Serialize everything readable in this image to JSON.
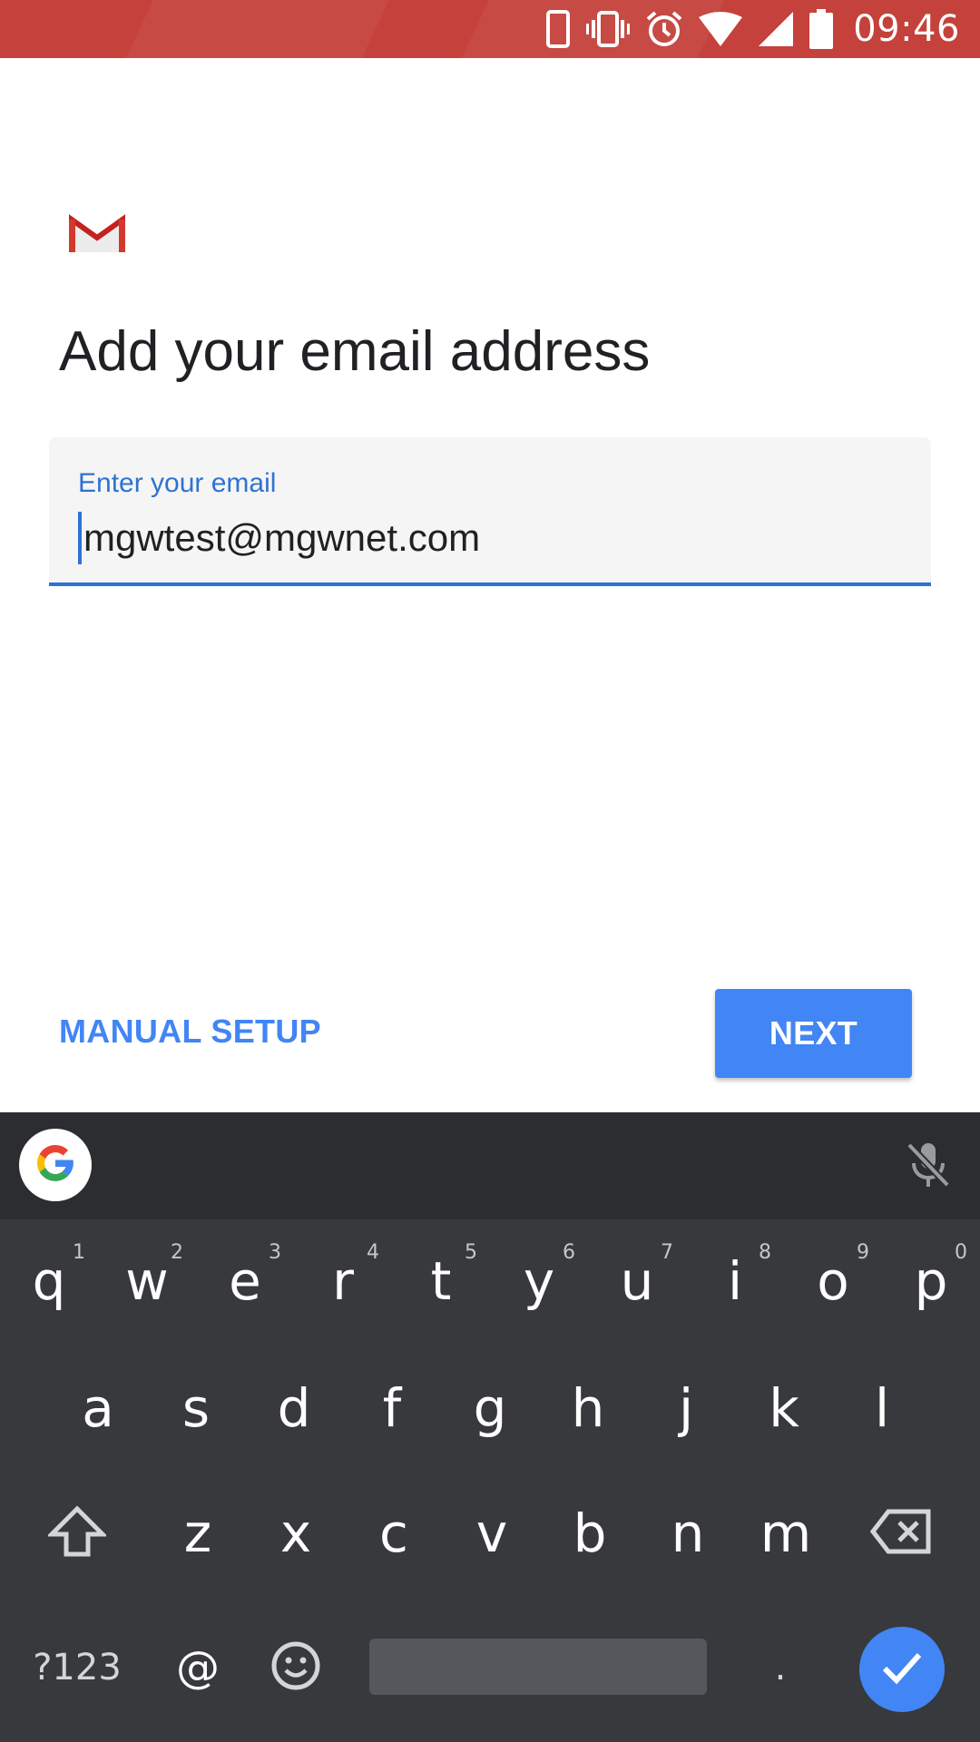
{
  "status_bar": {
    "time": "09:46",
    "icons": [
      "phone-icon",
      "vibrate-icon",
      "alarm-icon",
      "wifi-icon",
      "signal-icon",
      "battery-icon"
    ],
    "background": "#c5413b"
  },
  "logo": {
    "icon": "gmail-logo-icon"
  },
  "title": "Add your email address",
  "email_field": {
    "label": "Enter your email",
    "value": "mgwtest@mgwnet.com"
  },
  "actions": {
    "manual_setup": "MANUAL SETUP",
    "next": "NEXT"
  },
  "keyboard": {
    "row1": [
      {
        "char": "q",
        "hint": "1"
      },
      {
        "char": "w",
        "hint": "2"
      },
      {
        "char": "e",
        "hint": "3"
      },
      {
        "char": "r",
        "hint": "4"
      },
      {
        "char": "t",
        "hint": "5"
      },
      {
        "char": "y",
        "hint": "6"
      },
      {
        "char": "u",
        "hint": "7"
      },
      {
        "char": "i",
        "hint": "8"
      },
      {
        "char": "o",
        "hint": "9"
      },
      {
        "char": "p",
        "hint": "0"
      }
    ],
    "row2": [
      "a",
      "s",
      "d",
      "f",
      "g",
      "h",
      "j",
      "k",
      "l"
    ],
    "row3": [
      "z",
      "x",
      "c",
      "v",
      "b",
      "n",
      "m"
    ],
    "row4": {
      "symbols": "?123",
      "at": "@",
      "period": "."
    }
  },
  "colors": {
    "accent": "#4285f4",
    "field_underline": "#2e72d2",
    "keyboard_bg": "#37393d",
    "keyboard_toolbar": "#2b2d30"
  }
}
